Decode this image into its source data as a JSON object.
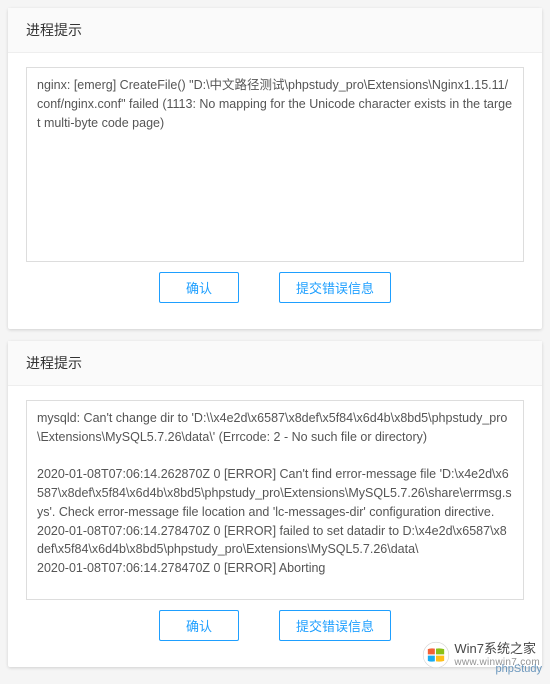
{
  "dialog1": {
    "title": "进程提示",
    "content": "nginx: [emerg] CreateFile() \"D:\\中文路径测试\\phpstudy_pro\\Extensions\\Nginx1.15.11/conf/nginx.conf\" failed (1113: No mapping for the Unicode character exists in the target multi-byte code page)",
    "confirm_label": "确认",
    "submit_label": "提交错误信息"
  },
  "dialog2": {
    "title": "进程提示",
    "content": "mysqld: Can't change dir to 'D:\\\\x4e2d\\x6587\\x8def\\x5f84\\x6d4b\\x8bd5\\phpstudy_pro\\Extensions\\MySQL5.7.26\\data\\' (Errcode: 2 - No such file or directory)\n\n2020-01-08T07:06:14.262870Z 0 [ERROR] Can't find error-message file 'D:\\x4e2d\\x6587\\x8def\\x5f84\\x6d4b\\x8bd5\\phpstudy_pro\\Extensions\\MySQL5.7.26\\share\\errmsg.sys'. Check error-message file location and 'lc-messages-dir' configuration directive.\n2020-01-08T07:06:14.278470Z 0 [ERROR] failed to set datadir to D:\\x4e2d\\x6587\\x8def\\x5f84\\x6d4b\\x8bd5\\phpstudy_pro\\Extensions\\MySQL5.7.26\\data\\\n2020-01-08T07:06:14.278470Z 0 [ERROR] Aborting",
    "confirm_label": "确认",
    "submit_label": "提交错误信息"
  },
  "watermark": {
    "brand": "Win7系统之家",
    "url": "www.winwin7.com",
    "phpstudy": "phpStudy"
  }
}
